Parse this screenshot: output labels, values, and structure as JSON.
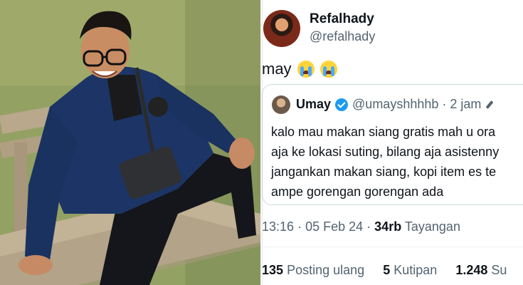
{
  "photo": {
    "description_icon": "person-on-bench-photo"
  },
  "tweet": {
    "author": {
      "name": "Refalhady",
      "handle": "@refalhady"
    },
    "text": "may",
    "emoji": [
      "loudly-crying-face",
      "loudly-crying-face"
    ],
    "quote": {
      "name": "Umay",
      "handle": "@umayshhhhb",
      "separator": "·",
      "time": "2 jam",
      "verified": true,
      "lines": [
        "kalo mau makan siang gratis mah u ora",
        "aja ke lokasi suting, bilang aja asistenny",
        "jangankan makan siang, kopi item es te",
        "ampe gorengan gorengan ada"
      ]
    },
    "meta": {
      "time": "13:16",
      "dot1": "·",
      "date": "05 Feb 24",
      "dot2": "·",
      "views_count": "34rb",
      "views_label": "Tayangan"
    },
    "stats": {
      "reposts_count": "135",
      "reposts_label": "Posting ulang",
      "quotes_count": "5",
      "quotes_label": "Kutipan",
      "likes_count": "1.248",
      "likes_label": "Su"
    }
  },
  "colors": {
    "text": "#0f1419",
    "secondary": "#536471",
    "verified": "#1d9bf0",
    "border": "#cfd9de"
  }
}
